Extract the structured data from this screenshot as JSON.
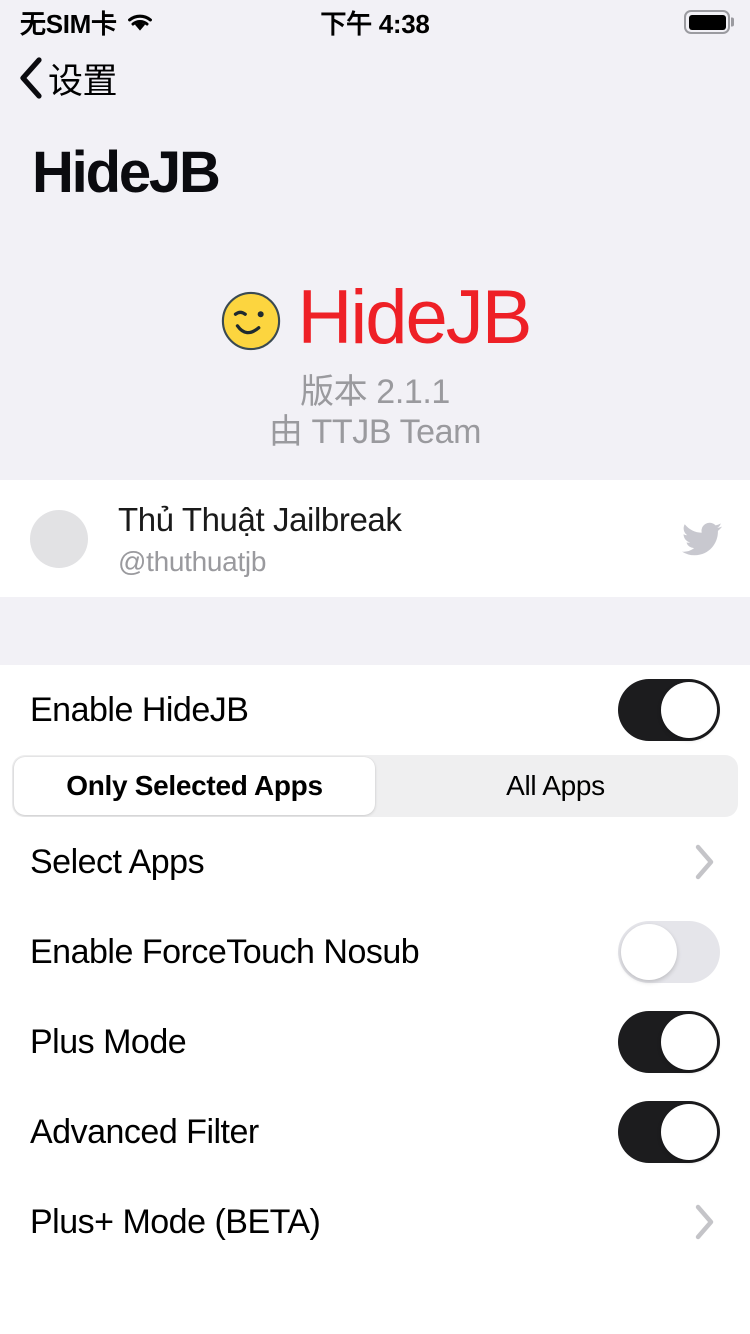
{
  "status_bar": {
    "carrier": "无SIM卡",
    "wifi_icon": "wifi-icon",
    "time": "下午 4:38",
    "battery_icon": "battery-full-icon"
  },
  "nav": {
    "back_icon": "chevron-left-icon",
    "back_label": "设置"
  },
  "hero": {
    "wordmark": "HideJB",
    "emoji": "winking-face-emoji",
    "title": "HideJB",
    "version": "版本 2.1.1",
    "author": "由 TTJB Team",
    "title_color": "#ee2026",
    "background": "#f2f1f6"
  },
  "twitter": {
    "avatar_icon": "avatar-placeholder",
    "name": "Thủ Thuật Jailbreak",
    "handle": "@thuthuatjb",
    "bird_icon": "twitter-bird-icon"
  },
  "settings": {
    "enable_row": {
      "label": "Enable HideJB",
      "toggle_state": "on"
    },
    "segmented": {
      "options": [
        "Only Selected Apps",
        "All Apps"
      ],
      "selected_index": 0
    },
    "rows": [
      {
        "label": "Select Apps",
        "accessory": "chevron"
      },
      {
        "label": "Enable ForceTouch Nosub",
        "accessory": "toggle",
        "toggle_state": "off"
      },
      {
        "label": "Plus Mode",
        "accessory": "toggle",
        "toggle_state": "on"
      },
      {
        "label": "Advanced Filter",
        "accessory": "toggle",
        "toggle_state": "on"
      },
      {
        "label": "Plus+ Mode (BETA)",
        "accessory": "chevron"
      }
    ]
  }
}
